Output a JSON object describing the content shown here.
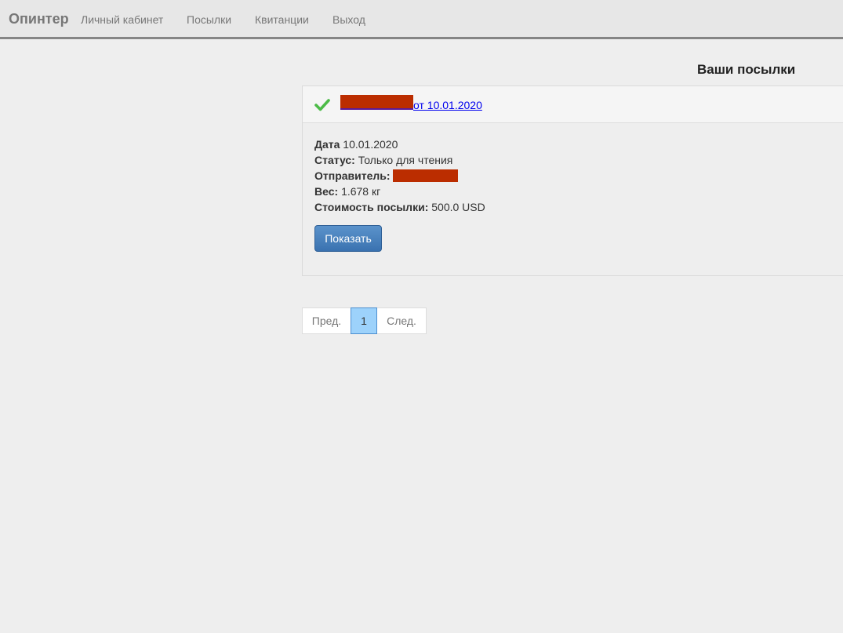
{
  "navbar": {
    "brand": "Опинтер",
    "links": [
      "Личный кабинет",
      "Посылки",
      "Квитанции",
      "Выход"
    ]
  },
  "page": {
    "heading": "Ваши посылки"
  },
  "parcel": {
    "link_suffix": "от 10.01.2020",
    "fields": {
      "date_label": "Дата",
      "date_value": "10.01.2020",
      "status_label": "Статус:",
      "status_value": "Только для чтения",
      "sender_label": "Отправитель:",
      "weight_label": "Вес:",
      "weight_value": "1.678 кг",
      "cost_label": "Стоимость посылки:",
      "cost_value": "500.0 USD"
    },
    "show_button": "Показать"
  },
  "pagination": {
    "prev": "Пред.",
    "current": "1",
    "next": "След."
  },
  "colors": {
    "check": "#4cbb47",
    "button": "#4a82c0",
    "active_page": "#9dd2fb",
    "redaction": "#bb2d00"
  }
}
